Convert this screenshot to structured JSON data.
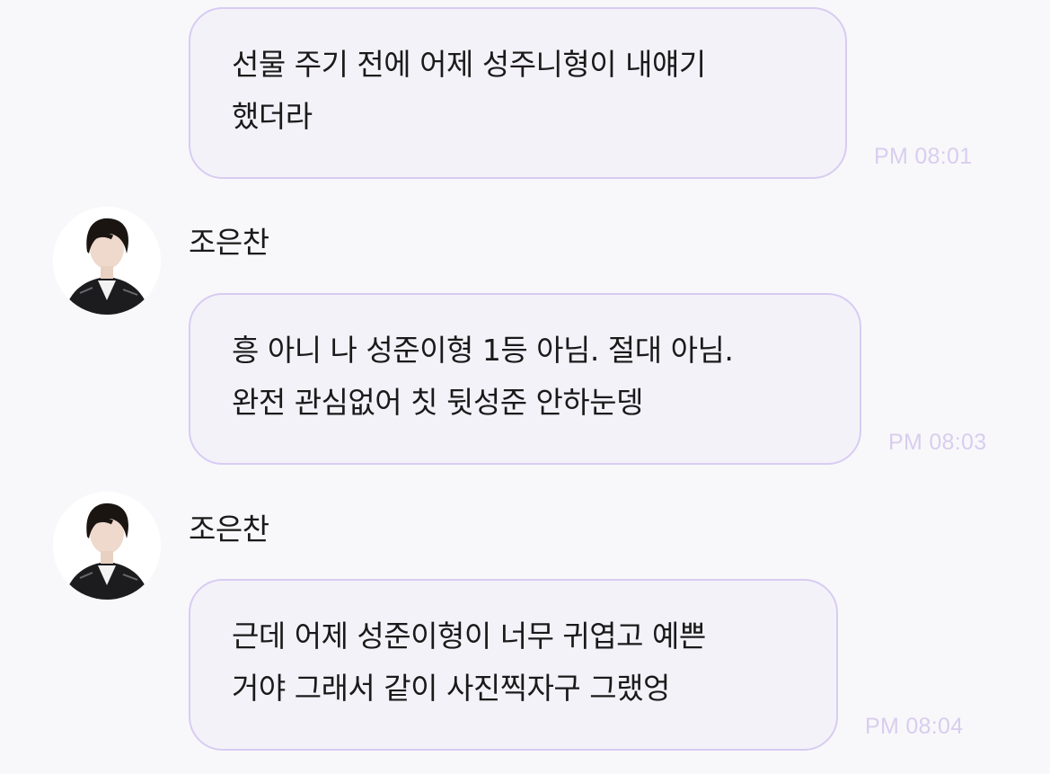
{
  "colors": {
    "background": "#f8f8fa",
    "bubble_fill": "#f4f2f9",
    "bubble_border": "#d8ccf2",
    "timestamp": "#d9cdef",
    "text": "#1a1a1a"
  },
  "messages": [
    {
      "sender": "",
      "lines": [
        "선물 주기 전에 어제 성주니형이 내얘기",
        "했더라"
      ],
      "time": "PM 08:01"
    },
    {
      "sender": "조은찬",
      "avatar_icon": "profile-photo",
      "lines": [
        "흥 아니 나 성준이형 1등 아님. 절대 아님.",
        "완전 관심없어 칫 뒷성준 안하눈뎅"
      ],
      "time": "PM 08:03"
    },
    {
      "sender": "조은찬",
      "avatar_icon": "profile-photo",
      "lines": [
        "근데 어제 성준이형이 너무 귀엽고 예쁜",
        "거야 그래서 같이 사진찍자구 그랬엉"
      ],
      "time": "PM 08:04"
    }
  ]
}
